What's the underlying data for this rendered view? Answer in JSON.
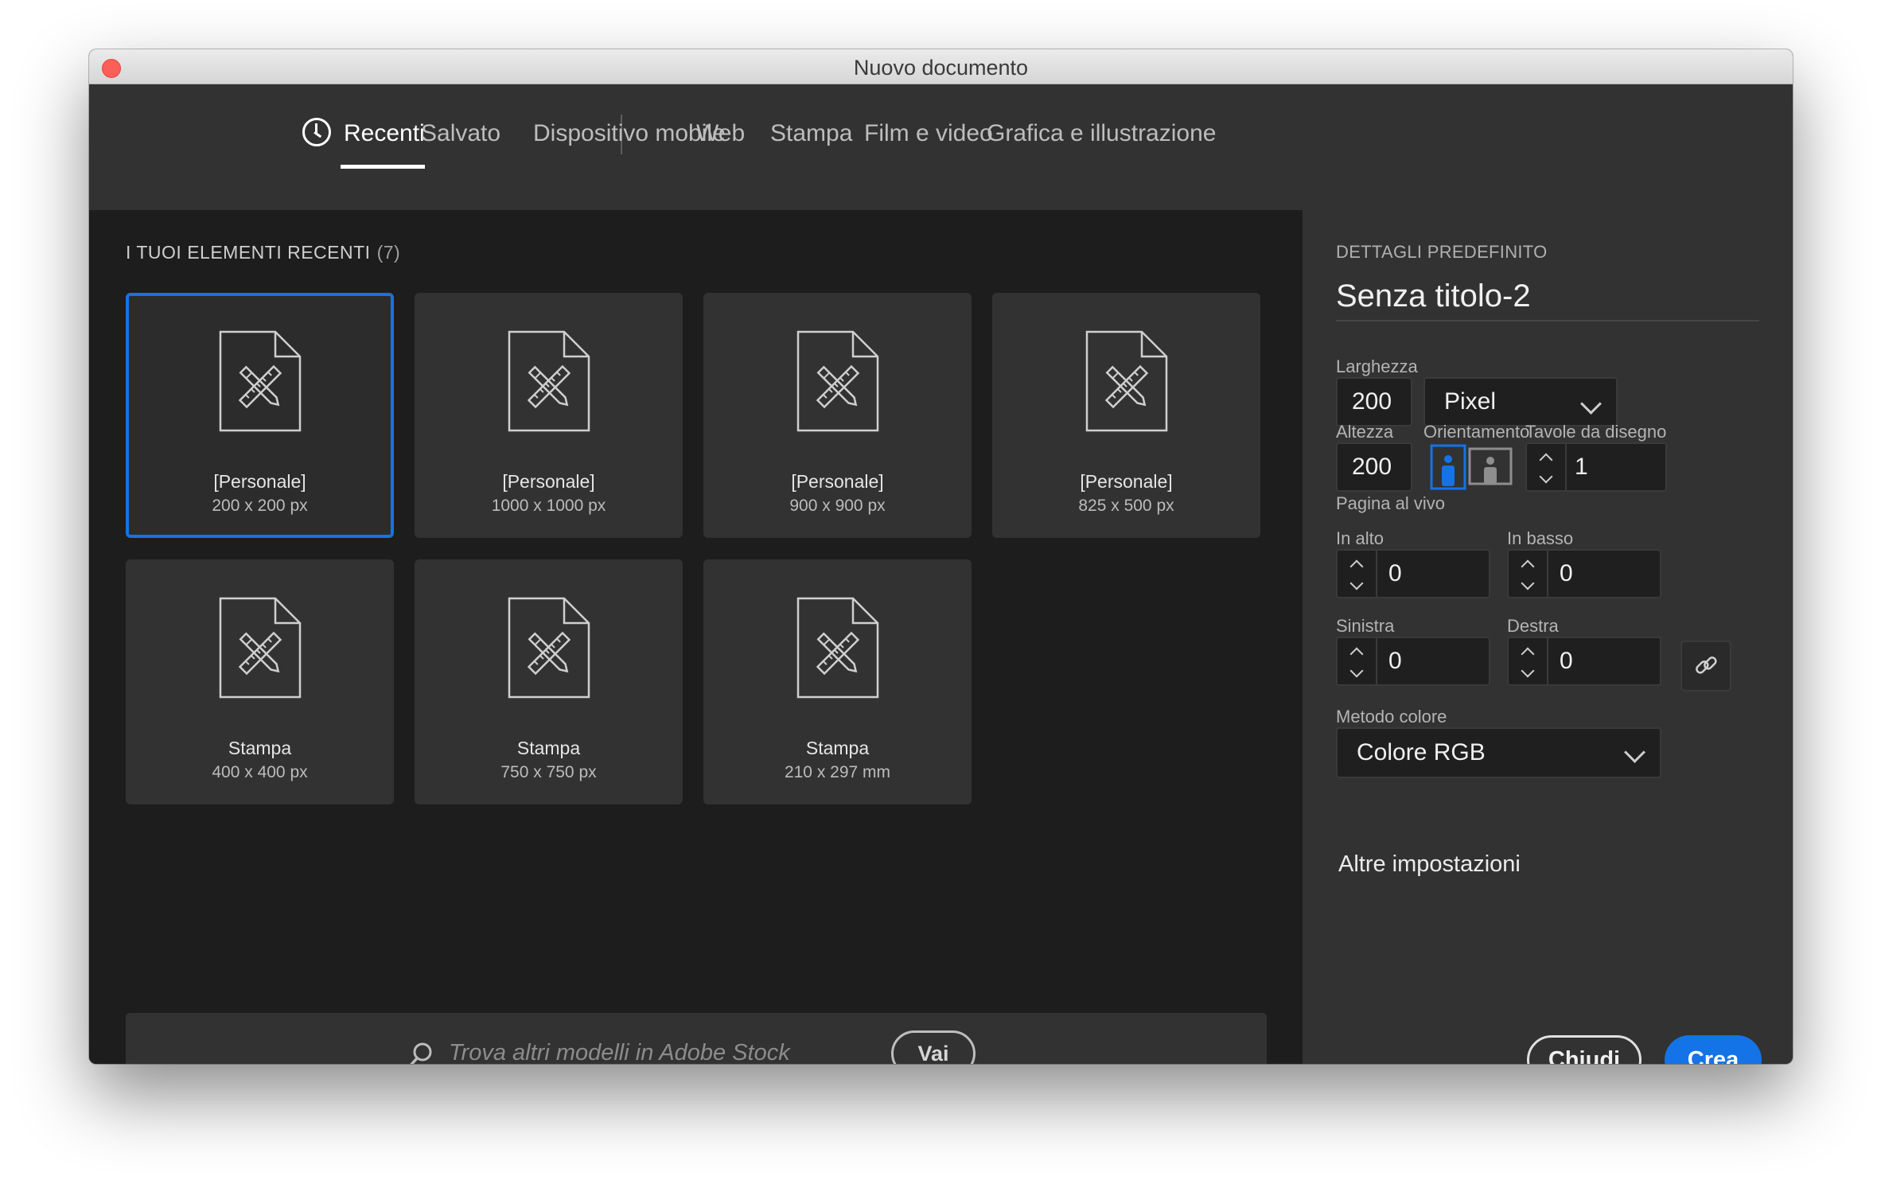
{
  "window": {
    "title": "Nuovo documento"
  },
  "tabs": [
    {
      "label": "Recenti",
      "active": true,
      "icon": "clock-icon"
    },
    {
      "label": "Salvato"
    },
    {
      "label": "Dispositivo mobile"
    },
    {
      "label": "Web"
    },
    {
      "label": "Stampa"
    },
    {
      "label": "Film e video"
    },
    {
      "label": "Grafica e illustrazione"
    }
  ],
  "recent": {
    "title": "I TUOI ELEMENTI RECENTI",
    "count": "(7)",
    "items": [
      {
        "name": "[Personale]",
        "size": "200 x 200 px",
        "selected": true
      },
      {
        "name": "[Personale]",
        "size": "1000 x 1000 px"
      },
      {
        "name": "[Personale]",
        "size": "900 x 900 px"
      },
      {
        "name": "[Personale]",
        "size": "825 x 500 px"
      },
      {
        "name": "Stampa",
        "size": "400 x 400 px"
      },
      {
        "name": "Stampa",
        "size": "750 x 750 px"
      },
      {
        "name": "Stampa",
        "size": "210 x 297 mm"
      }
    ]
  },
  "stock": {
    "placeholder": "Trova altri modelli in Adobe Stock",
    "go_label": "Vai"
  },
  "details": {
    "header": "DETTAGLI PREDEFINITO",
    "preset_name": "Senza titolo-2",
    "width_label": "Larghezza",
    "width_value": "200",
    "unit_value": "Pixel",
    "height_label": "Altezza",
    "height_value": "200",
    "orientation_label": "Orientamento",
    "artboards_label": "Tavole da disegno",
    "artboards_value": "1",
    "bleed_label": "Pagina al vivo",
    "bleed_top_label": "In alto",
    "bleed_top_value": "0",
    "bleed_bottom_label": "In basso",
    "bleed_bottom_value": "0",
    "bleed_left_label": "Sinistra",
    "bleed_left_value": "0",
    "bleed_right_label": "Destra",
    "bleed_right_value": "0",
    "color_mode_label": "Metodo colore",
    "color_mode_value": "Colore RGB",
    "more_settings": "Altre impostazioni"
  },
  "actions": {
    "close_label": "Chiudi",
    "create_label": "Crea"
  },
  "colors": {
    "accent": "#1473e6",
    "panel": "#323232",
    "background": "#1d1d1d"
  }
}
